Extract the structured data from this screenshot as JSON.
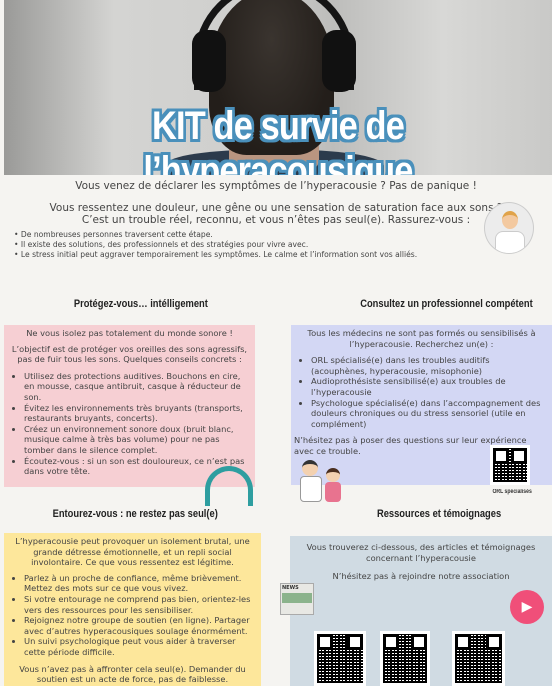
{
  "header": {
    "title": "KIT de survie de l’hyperacousique"
  },
  "intro": {
    "line1": "Vous venez de déclarer les symptômes de l’hyperacousie ? Pas de panique !",
    "line2": "Vous ressentez une douleur, une gêne ou une sensation de saturation face aux sons ?",
    "line3": "C’est un trouble réel, reconnu, et vous n’êtes pas seul(e). Rassurez-vous :",
    "bullets": [
      "De nombreuses personnes traversent cette étape.",
      "Il existe des solutions, des professionnels et des stratégies pour vivre avec.",
      "Le stress initial peut aggraver temporairement les symptômes. Le calme et l’information sont vos alliés."
    ]
  },
  "protect": {
    "title": "Protégez-vous… intélligement",
    "lead": "Ne vous isolez pas totalement du monde sonore !",
    "text": "L’objectif est de protéger vos oreilles des sons agressifs, pas de fuir tous les sons. Quelques conseils concrets :",
    "bullets": [
      "Utilisez des protections auditives. Bouchons en cire, en mousse, casque antibruit, casque à réducteur de son.",
      "Évitez les environnements très bruyants (transports, restaurants bruyants, concerts).",
      "Créez un environnement sonore doux (bruit blanc, musique calme à très bas volume) pour ne pas tomber dans le silence complet.",
      "Écoutez-vous : si un son est douloureux, ce n’est pas dans votre tête."
    ]
  },
  "consult": {
    "title": "Consultez un professionnel compétent",
    "lead": "Tous les médecins ne sont pas formés ou sensibilisés à l’hyperacousie. Recherchez un(e) :",
    "bullets": [
      "ORL spécialisé(e) dans les troubles auditifs (acouphènes, hyperacousie, misophonie)",
      "Audioprothésiste sensibilisé(e) aux troubles de l’hyperacousie",
      "Psychologue spécialisé(e) dans l’accompagnement des douleurs chroniques ou du stress sensoriel (utile en complément)"
    ],
    "footer": "N’hésitez pas à poser des questions sur leur expérience avec ce trouble.",
    "qr_label": "ORL spécialisés"
  },
  "support": {
    "title": "Entourez-vous : ne restez pas seul(e)",
    "lead": "L’hyperacousie peut provoquer un isolement brutal, une grande détresse émotionnelle, et un repli social involontaire. Ce que vous ressentez est légitime.",
    "bullets": [
      "Parlez à un proche de confiance, même brièvement. Mettez des mots sur ce que vous vivez.",
      "Si votre entourage ne comprend pas bien, orientez-les vers des ressources pour les sensibiliser.",
      "Rejoignez notre groupe de soutien (en ligne). Partager avec d’autres hyperacousiques soulage énormément.",
      "Un suivi psychologique peut vous aider à traverser cette période difficile."
    ],
    "footer": "Vous n’avez pas à affronter cela seul(e). Demander du soutien est un acte de force, pas de faiblesse."
  },
  "resources": {
    "title": "Ressources et témoignages",
    "lead": "Vous trouverez ci-dessous, des articles et témoignages concernant l’hyperacousie",
    "join": "N’hésitez pas à rejoindre notre association",
    "news_label": "NEWS"
  },
  "colors": {
    "title_stroke": "#4a90bb",
    "pink": "#f6cfd3",
    "lavender": "#d3d7f4",
    "yellow": "#fde79b",
    "blue_grey": "#d0dbe3",
    "play": "#f04f79"
  }
}
